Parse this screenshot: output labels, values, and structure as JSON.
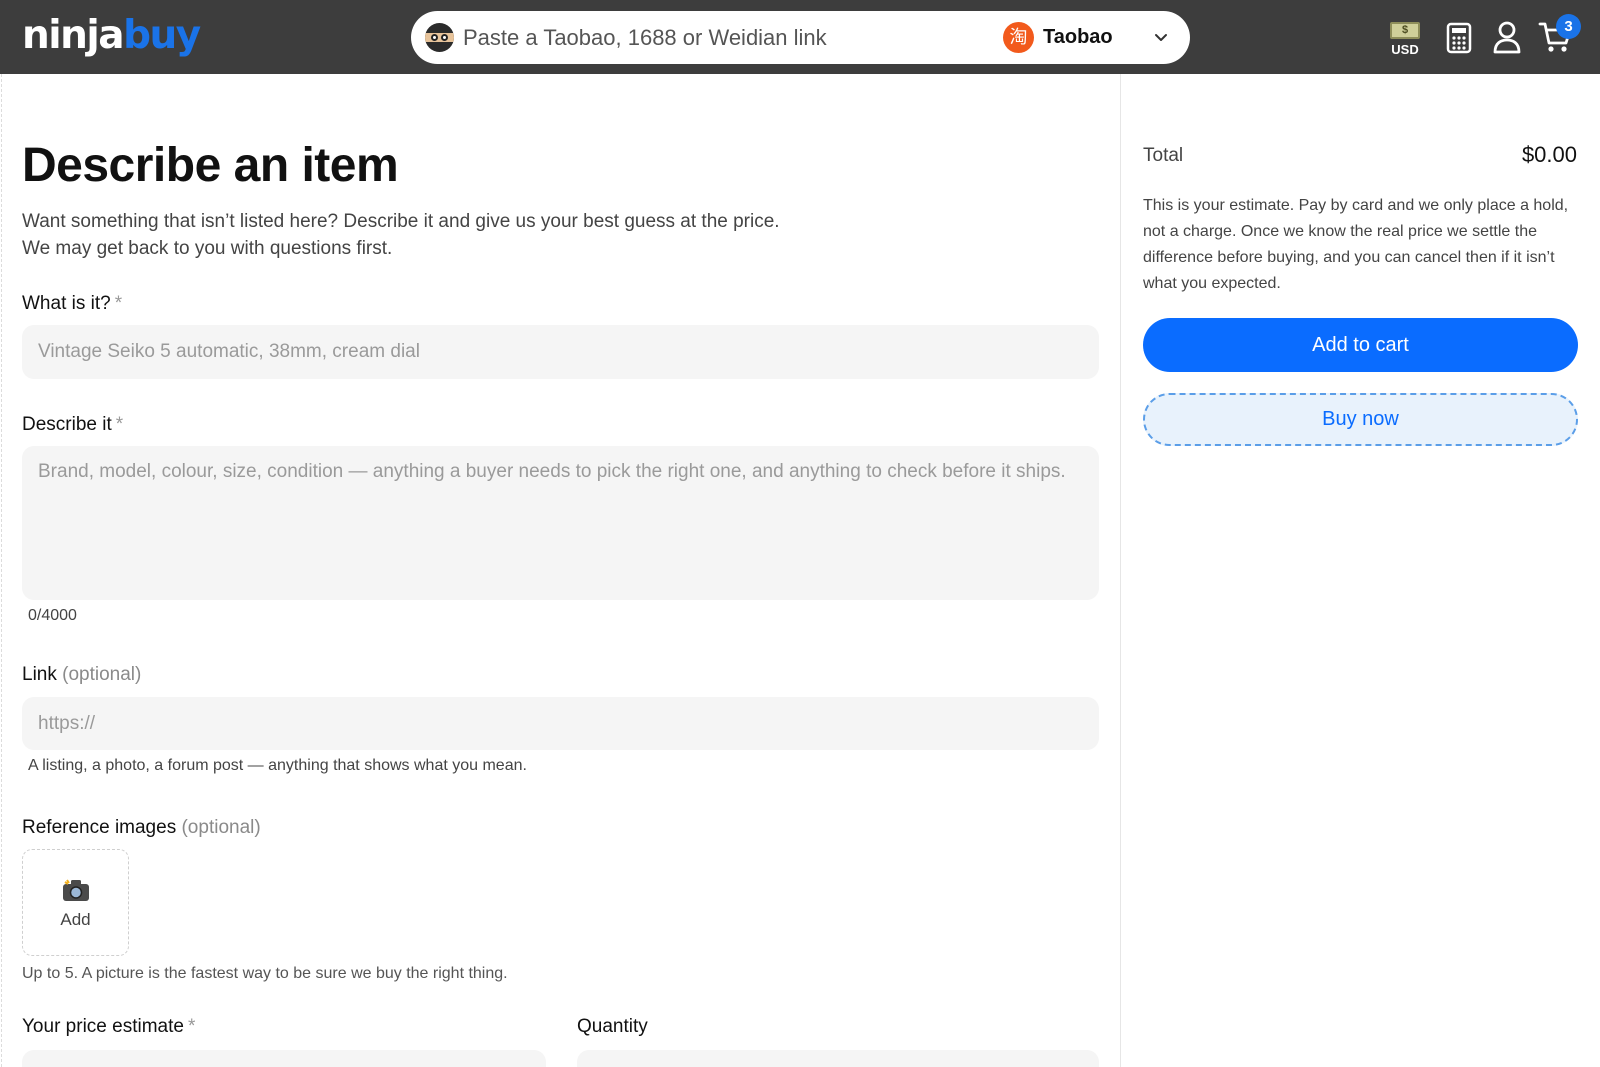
{
  "header": {
    "logo_part1": "ninja",
    "logo_part2": "buy",
    "search_placeholder": "Paste a Taobao, 1688 or Weidian link",
    "platform_label": "Taobao",
    "platform_icon_glyph": "淘",
    "currency_label": "USD",
    "cart_count": "3",
    "icons": [
      "ninja-icon",
      "taobao-icon",
      "chevron-down-icon",
      "currency-icon",
      "calculator-icon",
      "user-icon",
      "cart-icon"
    ]
  },
  "form": {
    "title": "Describe an item",
    "description": "Want something that isn’t listed here? Describe it and give us your best guess at the price. We may get back to you with questions first.",
    "what_label": "What is it?",
    "what_placeholder": "Vintage Seiko 5 automatic, 38mm, cream dial",
    "describe_label": "Describe it",
    "describe_placeholder": "Brand, model, colour, size, condition — anything a buyer needs to pick the right one, and anything to check before it ships.",
    "char_count": "0/4000",
    "link_label": "Link",
    "optional_text": "(optional)",
    "link_placeholder": "https://",
    "link_hint": "A listing, a photo, a forum post — anything that shows what you mean.",
    "ref_label": "Reference images",
    "add_label": "Add",
    "ref_hint": "Up to 5. A picture is the fastest way to be sure we buy the right thing.",
    "price_label": "Your price estimate",
    "quantity_label": "Quantity",
    "required_mark": "*"
  },
  "sidebar": {
    "total_label": "Total",
    "total_value": "$0.00",
    "note": "This is your estimate. Pay by card and we only place a hold, not a charge. Once we know the real price we settle the difference before buying, and you can cancel then if it isn’t what you expected.",
    "add_to_cart": "Add to cart",
    "buy_now": "Buy now"
  },
  "colors": {
    "header_bg": "#3d3d3d",
    "brand_blue": "#1a73e8",
    "primary_button": "#0a6cff",
    "taobao_orange": "#f25a1c"
  }
}
